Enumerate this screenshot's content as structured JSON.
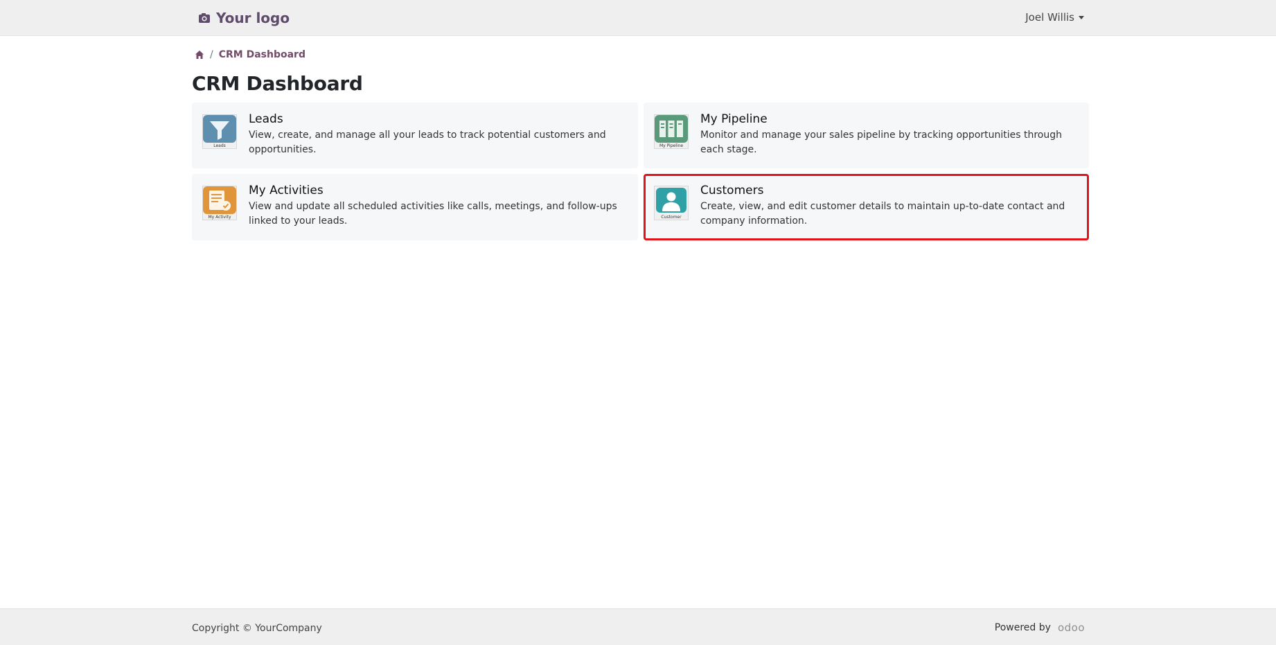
{
  "header": {
    "logo_text": "Your logo",
    "user_name": "Joel Willis"
  },
  "breadcrumb": {
    "current": "CRM Dashboard"
  },
  "page": {
    "title": "CRM Dashboard"
  },
  "cards": [
    {
      "title": "Leads",
      "description": "View, create, and manage all your leads to track potential customers and opportunities.",
      "thumb_label": "Leads",
      "icon": "funnel-icon",
      "color": "#5e8fae"
    },
    {
      "title": "My Pipeline",
      "description": "Monitor and manage your sales pipeline by tracking opportunities through each stage.",
      "thumb_label": "My Pipeline",
      "icon": "kanban-icon",
      "color": "#5a9a7a"
    },
    {
      "title": "My Activities",
      "description": "View and update all scheduled activities like calls, meetings, and follow-ups linked to your leads.",
      "thumb_label": "My Activity",
      "icon": "checklist-icon",
      "color": "#e0953a"
    },
    {
      "title": "Customers",
      "description": "Create, view, and edit customer details to maintain up-to-date contact and company information.",
      "thumb_label": "Customer",
      "icon": "person-icon",
      "color": "#2fa0a6"
    }
  ],
  "footer": {
    "copyright": "Copyright © YourCompany",
    "powered_by": "Powered by",
    "brand": "odoo"
  },
  "colors": {
    "accent": "#714b67",
    "highlight": "#e0141b"
  }
}
